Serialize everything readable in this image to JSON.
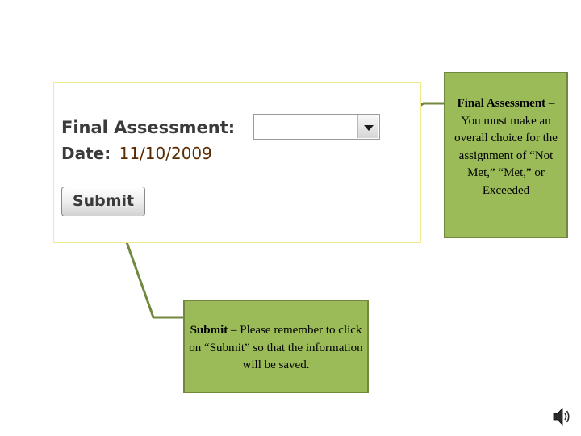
{
  "form": {
    "final_assessment_label": "Final Assessment:",
    "final_assessment_value": "",
    "date_label": "Date:",
    "date_value": "11/10/2009",
    "submit_label": "Submit"
  },
  "callouts": {
    "final_assessment": {
      "title": "Final Assessment",
      "body": " – You must make an overall choice for the assignment of “Not Met,” “Met,” or Exceeded"
    },
    "submit": {
      "title": "Submit",
      "body": " – Please remember to click on “Submit” so that the information will be saved."
    }
  },
  "colors": {
    "callout_fill": "#9bbb59",
    "callout_border": "#71893f",
    "panel_border": "#f0ec8a"
  },
  "icons": {
    "speaker": "speaker-icon",
    "dropdown": "chevron-down-icon"
  }
}
